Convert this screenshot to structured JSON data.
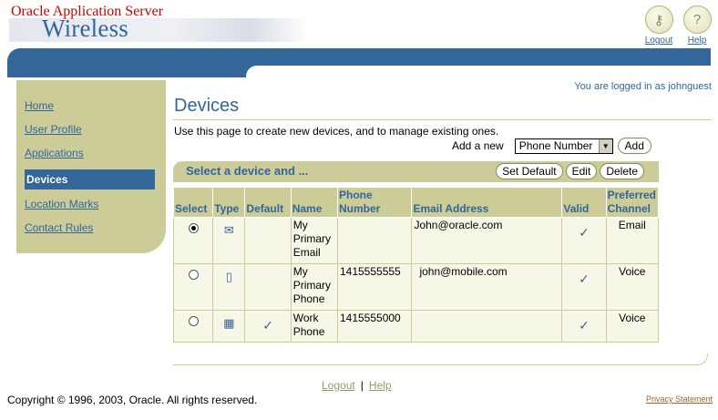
{
  "header": {
    "brand_top": "Oracle Application Server",
    "brand_main": "Wireless",
    "logout_label": "Logout",
    "help_label": "Help"
  },
  "status": {
    "logged_in": "You are logged in as johnguest"
  },
  "nav": {
    "items": [
      {
        "label": "Home",
        "active": false
      },
      {
        "label": "User Profile",
        "active": false
      },
      {
        "label": "Applications",
        "active": false
      },
      {
        "label": "Devices",
        "active": true
      },
      {
        "label": "Location Marks",
        "active": false
      },
      {
        "label": "Contact Rules",
        "active": false
      }
    ]
  },
  "main": {
    "title": "Devices",
    "description": "Use this page to create new devices, and to manage existing ones.",
    "add_label": "Add a new",
    "device_type_selected": "Phone Number",
    "add_button": "Add"
  },
  "panel": {
    "title": "Select a device and ...",
    "buttons": {
      "set_default": "Set Default",
      "edit": "Edit",
      "delete": "Delete"
    }
  },
  "table": {
    "headers": {
      "select": "Select",
      "type": "Type",
      "default": "Default",
      "name": "Name",
      "phone": "Phone Number",
      "email": "Email Address",
      "valid": "Valid",
      "preferred": "Preferred Channel"
    },
    "rows": [
      {
        "selected": true,
        "type_icon": "envelope-icon",
        "default": false,
        "name": "My Primary Email",
        "phone": "",
        "email": "John@oracle.com",
        "valid": true,
        "preferred": "Email"
      },
      {
        "selected": false,
        "type_icon": "mobile-phone-icon",
        "default": false,
        "name": "My Primary Phone",
        "phone": "1415555555",
        "email": "john@mobile.com",
        "valid": true,
        "preferred": "Voice"
      },
      {
        "selected": false,
        "type_icon": "desk-phone-icon",
        "default": true,
        "name": "Work Phone",
        "phone": "1415555000",
        "email": "",
        "valid": true,
        "preferred": "Voice"
      }
    ]
  },
  "footer": {
    "logout": "Logout",
    "separator": "|",
    "help": "Help",
    "copyright": "Copyright © 1996, 2003, Oracle. All rights reserved.",
    "privacy": "Privacy Statement"
  },
  "colors": {
    "brand_blue": "#336699",
    "khaki": "#cccc99",
    "oracle_red": "#cc0000"
  }
}
